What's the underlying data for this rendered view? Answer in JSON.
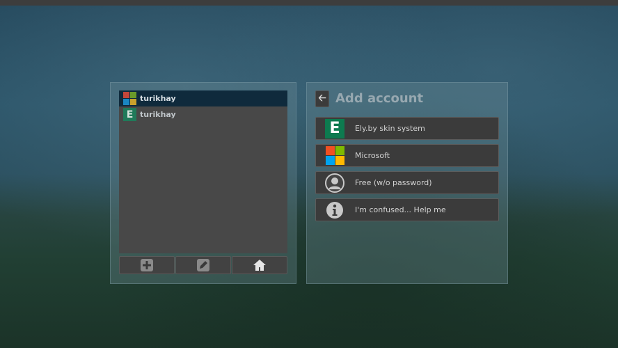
{
  "accounts": [
    {
      "name": "turikhay",
      "type": "microsoft",
      "selected": true
    },
    {
      "name": "turikhay",
      "type": "ely",
      "selected": false
    }
  ],
  "ely_letter": "E",
  "title": "Add account",
  "options": [
    {
      "label": "Ely.by skin system",
      "icon": "ely-icon"
    },
    {
      "label": "Microsoft",
      "icon": "microsoft-icon"
    },
    {
      "label": "Free (w/o password)",
      "icon": "user-icon"
    },
    {
      "label": "I'm confused... Help me",
      "icon": "info-icon"
    }
  ],
  "colors": {
    "ms_red": "#f25022",
    "ms_green": "#7fba00",
    "ms_blue": "#00a4ef",
    "ms_yellow": "#ffb900",
    "ely_green": "#207a5a",
    "selected": "#0f2a3c"
  }
}
